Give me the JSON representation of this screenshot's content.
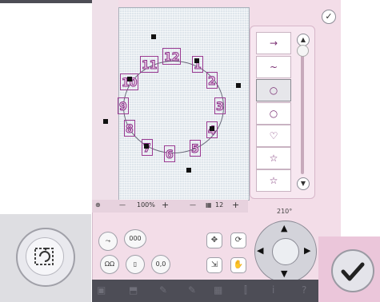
{
  "clock_digits": [
    "12",
    "1",
    "2",
    "3",
    "4",
    "5",
    "6",
    "7",
    "8",
    "9",
    "10",
    "11"
  ],
  "zoom": {
    "minus": "—",
    "value": "100%",
    "plus": "+",
    "minus2": "—",
    "stitch_value": "12",
    "plus2": "+"
  },
  "rotation_label": "210°",
  "stitch_list": [
    "→",
    "~",
    "○",
    "○",
    "♡",
    "☆",
    "☆"
  ],
  "buttons": {
    "seq1": "000",
    "seq2": "▯",
    "seq3": "0,0"
  },
  "taskbar_items": [
    "▣",
    "⬒",
    "✎",
    "✎",
    "▦",
    "⫿",
    "i",
    "?"
  ],
  "colors": {
    "panel": "#f3dde8",
    "accent": "#8a2d88",
    "taskbar": "#4d4d56"
  }
}
